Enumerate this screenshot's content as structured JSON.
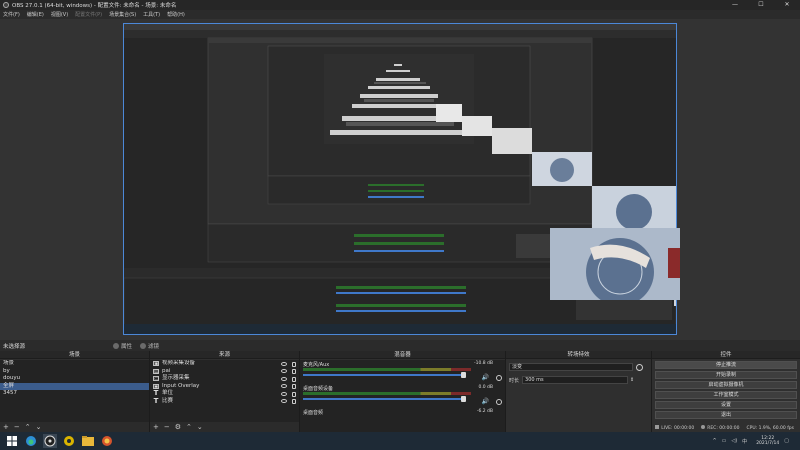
{
  "titlebar": {
    "title": "OBS 27.0.1 (64-bit, windows) - 配置文件: 未命名 - 场景: 未命名",
    "min": "—",
    "max": "☐",
    "close": "✕"
  },
  "menu": [
    "文件(F)",
    "编辑(E)",
    "视图(V)",
    "配置文件(P)",
    "场景集合(S)",
    "工具(T)",
    "帮助(H)"
  ],
  "scene_header": {
    "current": "未选择源",
    "properties": "属性",
    "filters": "滤镜"
  },
  "scenes": {
    "title": "场景",
    "items": [
      "场景",
      "by",
      "douyu",
      "全屏",
      "3457"
    ],
    "selected_index": 3
  },
  "sources": {
    "title": "来源",
    "items": [
      {
        "icon": "video-capture-icon",
        "glyph": "▣",
        "label": "视频采集设备"
      },
      {
        "icon": "image-icon",
        "glyph": "▤",
        "label": "pai"
      },
      {
        "icon": "display-capture-icon",
        "glyph": "▭",
        "label": "显示器采集"
      },
      {
        "icon": "input-overlay-icon",
        "glyph": "◉",
        "label": "Input Overlay"
      },
      {
        "icon": "text-icon",
        "glyph": "T",
        "label": "单位"
      },
      {
        "icon": "text-icon",
        "glyph": "T",
        "label": "比赛"
      }
    ]
  },
  "mixer": {
    "title": "混音器",
    "channels": [
      {
        "name": "麦克风/Aux",
        "db": "-10.8 dB",
        "level": 0.93
      },
      {
        "name": "桌面音频设备",
        "db": "0.0 dB",
        "level": 0.93
      },
      {
        "name": "桌面音频",
        "db": "-6.2 dB",
        "level": 0.5
      }
    ]
  },
  "transitions": {
    "title": "转场特效",
    "type": "淡变",
    "duration_label": "时长",
    "duration": "300 ms"
  },
  "controls": {
    "title": "控件",
    "buttons": [
      "停止推流",
      "开始录制",
      "启动虚拟摄像机",
      "工作室模式",
      "设置",
      "退出"
    ],
    "active_index": 0
  },
  "status": {
    "live_label": "LIVE:",
    "live_time": "00:00:00",
    "rec_label": "REC:",
    "rec_time": "00:00:00",
    "cpu": "CPU: 1.9%, 60.00 fps"
  },
  "taskbar": {
    "lang": "中",
    "time": "12:22",
    "date": "2021/7/14"
  },
  "colors": {
    "accent": "#3f78c9",
    "canvas_border": "#4c88d8",
    "selected": "#3b5c8c",
    "taskbar": "#1e2a36"
  }
}
